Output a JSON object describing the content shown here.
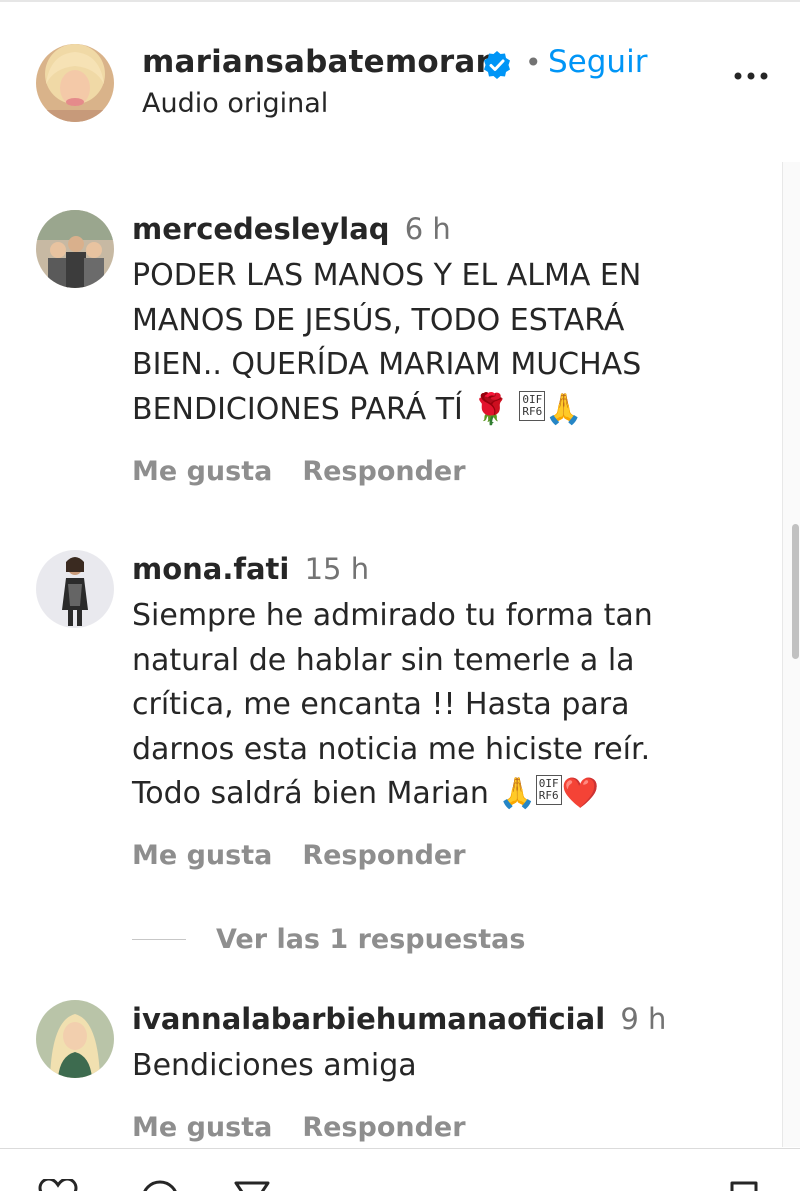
{
  "post": {
    "owner": "mariansabatemoran",
    "separator": "•",
    "follow_label": "Seguir",
    "audio": "Audio original"
  },
  "comments": [
    {
      "user": "mercedesleylaq",
      "time": "6 h",
      "lines": [
        "PODER LAS MANOS Y EL ALMA EN",
        "MANOS DE JESÚS, TODO ESTARÁ",
        "BIEN.. QUERÍDA MARIAM MUCHAS",
        "BENDICIONES PARÁ TÍ"
      ],
      "emojis": [
        "🌹",
        "🙏"
      ],
      "like_label": "Me gusta",
      "reply_label": "Responder"
    },
    {
      "user": "mona.fati",
      "time": "15 h",
      "lines": [
        "Siempre he admirado tu forma tan",
        "natural de hablar sin temerle a la",
        "crítica, me encanta !! Hasta para",
        "darnos esta noticia me hiciste reír.",
        "Todo saldrá bien Marian"
      ],
      "emojis": [
        "🙏",
        "❤️"
      ],
      "like_label": "Me gusta",
      "reply_label": "Responder"
    },
    {
      "user": "ivannalabarbiehumanaoficial",
      "time": "9 h",
      "lines": [
        "Bendiciones amiga"
      ],
      "like_label": "Me gusta",
      "reply_label": "Responder"
    }
  ],
  "view_replies": "Ver las 1 respuestas",
  "icons": {
    "verified": "verified-badge-icon",
    "more": "more-options-icon",
    "like": "heart-icon",
    "comment": "comment-icon",
    "share": "share-icon",
    "save": "bookmark-icon"
  },
  "colors": {
    "accent": "#0095f6",
    "muted": "#8e8e8e",
    "text": "#262626"
  }
}
